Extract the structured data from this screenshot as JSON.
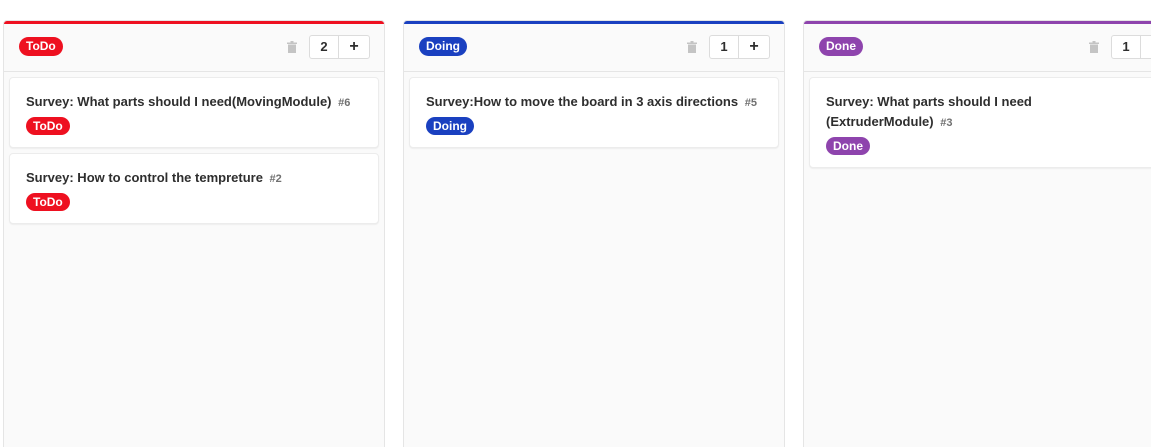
{
  "colors": {
    "todo": "#ee1020",
    "doing": "#1a40c0",
    "done": "#8e44ad"
  },
  "columns": [
    {
      "label": "ToDo",
      "count": "2",
      "add": "+",
      "trash_icon": "trash-icon",
      "cards": [
        {
          "title": "Survey: What parts should I need(MovingModule)",
          "number": "#6",
          "label": "ToDo"
        },
        {
          "title": "Survey: How to control the tempreture",
          "number": "#2",
          "label": "ToDo"
        }
      ]
    },
    {
      "label": "Doing",
      "count": "1",
      "add": "+",
      "trash_icon": "trash-icon",
      "cards": [
        {
          "title": "Survey:How to move the board in 3 axis directions",
          "number": "#5",
          "label": "Doing"
        }
      ]
    },
    {
      "label": "Done",
      "count": "1",
      "add": "+",
      "trash_icon": "trash-icon",
      "cards": [
        {
          "title": "Survey: What parts should I need (ExtruderModule)",
          "number": "#3",
          "label": "Done"
        }
      ]
    }
  ]
}
